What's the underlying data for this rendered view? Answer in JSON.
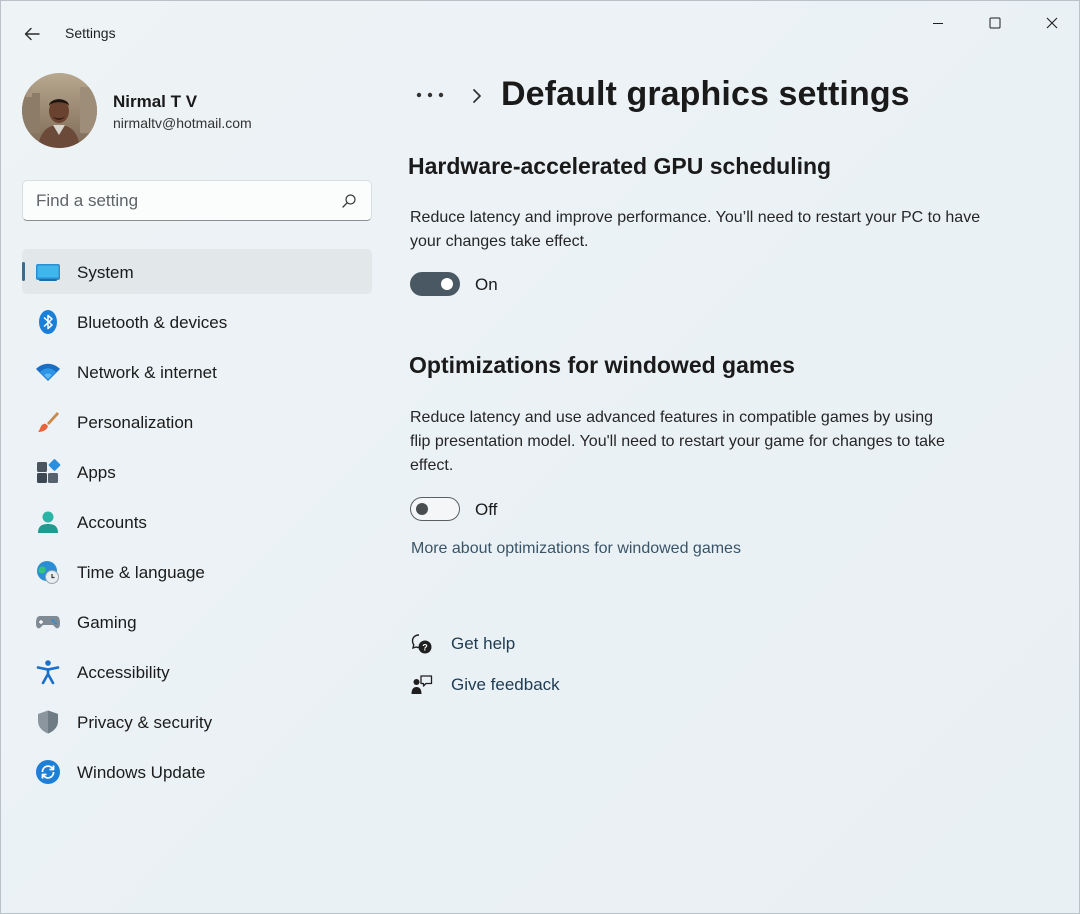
{
  "window": {
    "app_title": "Settings"
  },
  "profile": {
    "name": "Nirmal T V",
    "email": "nirmaltv@hotmail.com"
  },
  "search": {
    "placeholder": "Find a setting"
  },
  "nav": {
    "items": [
      {
        "label": "System",
        "icon": "system-icon",
        "active": true
      },
      {
        "label": "Bluetooth & devices",
        "icon": "bluetooth-icon"
      },
      {
        "label": "Network & internet",
        "icon": "wifi-icon"
      },
      {
        "label": "Personalization",
        "icon": "paintbrush-icon"
      },
      {
        "label": "Apps",
        "icon": "apps-icon"
      },
      {
        "label": "Accounts",
        "icon": "person-icon"
      },
      {
        "label": "Time & language",
        "icon": "globe-clock-icon"
      },
      {
        "label": "Gaming",
        "icon": "gamepad-icon"
      },
      {
        "label": "Accessibility",
        "icon": "accessibility-icon"
      },
      {
        "label": "Privacy & security",
        "icon": "shield-icon"
      },
      {
        "label": "Windows Update",
        "icon": "update-icon"
      }
    ]
  },
  "page": {
    "breadcrumb_more": "•••",
    "title": "Default graphics settings"
  },
  "gpu_scheduling": {
    "title": "Hardware-accelerated GPU scheduling",
    "description": "Reduce latency and improve performance. You’ll need to restart your PC to have your changes take effect.",
    "state": "On"
  },
  "windowed_games": {
    "title": "Optimizations for windowed games",
    "description": "Reduce latency and use advanced features in compatible games by using flip presentation model. You'll need to restart your game for changes to take effect.",
    "state": "Off",
    "link": "More about optimizations for windowed games"
  },
  "help": {
    "get_help": "Get help",
    "give_feedback": "Give feedback"
  },
  "colors": {
    "accent": "#3c6b8e",
    "toggle_on": "#4a5863"
  }
}
